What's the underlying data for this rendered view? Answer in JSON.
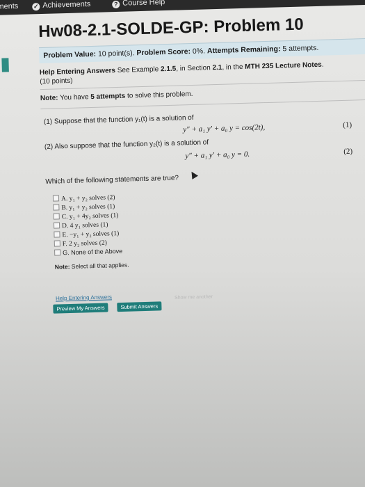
{
  "nav": {
    "items": [
      {
        "label": "ements"
      },
      {
        "label": "Achievements",
        "icon": "trophy-icon"
      },
      {
        "label": "Course Help",
        "icon": "help-icon"
      }
    ]
  },
  "problem": {
    "title": "Hw08-2.1-SOLDE-GP: Problem 10",
    "value_label": "Problem Value:",
    "value": "10 point(s).",
    "score_label": "Problem Score:",
    "score": "0%.",
    "attempts_label": "Attempts Remaining:",
    "attempts": "5 attempts."
  },
  "help": {
    "heading": "Help Entering Answers",
    "text1": "See Example",
    "example": "2.1.5",
    "text2": ", in Section",
    "section": "2.1",
    "text3": ", in the",
    "notes": "MTH 235 Lecture Notes",
    "points": "(10 points)"
  },
  "note": {
    "label": "Note:",
    "text1": "You have",
    "attempts": "5 attempts",
    "text2": "to solve this problem."
  },
  "part1": {
    "text": "(1) Suppose that the function y₁(t) is a solution of",
    "equation": "y″ + a₁ y′ + a₀ y = cos(2t),",
    "tag": "(1)"
  },
  "part2": {
    "text": "(2) Also suppose that the function y₂(t) is a solution of",
    "equation": "y″ + a₁ y′ + a₀ y = 0.",
    "tag": "(2)"
  },
  "question": "Which of the following statements are true?",
  "options": [
    "A. y₁ + y₂ solves (2)",
    "B. y₁ + y₂ solves (1)",
    "C. y₁ + 4y₂ solves (1)",
    "D. 4 y₁ solves (1)",
    "E. −y₁ + y₂ solves (1)",
    "F. 2 y₂ solves (2)",
    "G. None of the Above"
  ],
  "select_note": {
    "label": "Note:",
    "text": "Select all that applies."
  },
  "links": {
    "help_entering": "Help Entering Answers"
  },
  "buttons": {
    "preview": "Preview My Answers",
    "submit": "Submit Answers",
    "show_another": "Show me another"
  },
  "colors": {
    "accent": "#1f7d7a",
    "info_bar": "#d5e5ec"
  }
}
